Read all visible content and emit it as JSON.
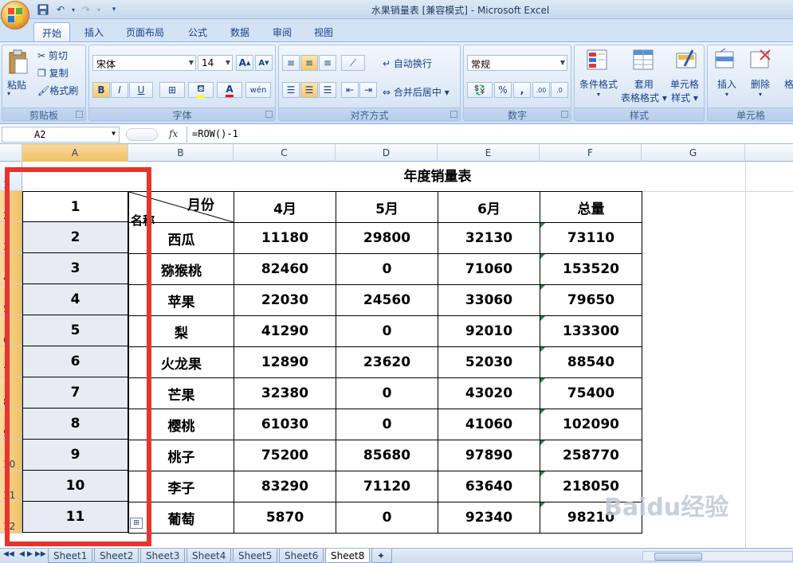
{
  "window": {
    "title": "水果销量表  [兼容模式] - Microsoft Excel"
  },
  "ribbon_tabs": [
    "开始",
    "插入",
    "页面布局",
    "公式",
    "数据",
    "审阅",
    "视图"
  ],
  "clipboard": {
    "paste": "粘贴",
    "cut": "剪切",
    "copy": "复制",
    "format_painter": "格式刷",
    "label": "剪贴板"
  },
  "font": {
    "name": "宋体",
    "size": "14",
    "bold": "B",
    "italic": "I",
    "underline": "U",
    "label": "字体",
    "phonetic": "wén"
  },
  "alignment": {
    "wrap": "自动换行",
    "merge": "合并后居中",
    "label": "对齐方式"
  },
  "number": {
    "format": "常规",
    "percent": "%",
    "comma": ",",
    "label": "数字"
  },
  "styles": {
    "conditional": "条件格式",
    "table_fmt_1": "套用",
    "table_fmt_2": "表格格式",
    "cell_styles_1": "单元格",
    "cell_styles_2": "样式",
    "label": "样式"
  },
  "cells": {
    "insert": "插入",
    "delete": "删除",
    "format": "格",
    "label": "单元格"
  },
  "formula_bar": {
    "name_box": "A2",
    "fx": "fx",
    "formula": "=ROW()-1"
  },
  "columns": [
    "A",
    "B",
    "C",
    "D",
    "E",
    "F",
    "G"
  ],
  "rows": [
    "1",
    "2",
    "3",
    "4",
    "5",
    "6",
    "7",
    "8",
    "9",
    "10",
    "11",
    "12"
  ],
  "sheet": {
    "title": "年度销量表",
    "header_diag_top": "月份",
    "header_diag_bottom": "名称",
    "headers": [
      "4月",
      "5月",
      "6月",
      "总量"
    ],
    "row_numbers": [
      "1",
      "2",
      "3",
      "4",
      "5",
      "6",
      "7",
      "8",
      "9",
      "10",
      "11"
    ],
    "fruits": [
      {
        "name": "西瓜",
        "m4": "11180",
        "m5": "29800",
        "m6": "32130",
        "total": "73110"
      },
      {
        "name": "猕猴桃",
        "m4": "82460",
        "m5": "0",
        "m6": "71060",
        "total": "153520"
      },
      {
        "name": "苹果",
        "m4": "22030",
        "m5": "24560",
        "m6": "33060",
        "total": "79650"
      },
      {
        "name": "梨",
        "m4": "41290",
        "m5": "0",
        "m6": "92010",
        "total": "133300"
      },
      {
        "name": "火龙果",
        "m4": "12890",
        "m5": "23620",
        "m6": "52030",
        "total": "88540"
      },
      {
        "name": "芒果",
        "m4": "32380",
        "m5": "0",
        "m6": "43020",
        "total": "75400"
      },
      {
        "name": "樱桃",
        "m4": "61030",
        "m5": "0",
        "m6": "41060",
        "total": "102090"
      },
      {
        "name": "桃子",
        "m4": "75200",
        "m5": "85680",
        "m6": "97890",
        "total": "258770"
      },
      {
        "name": "李子",
        "m4": "83290",
        "m5": "71120",
        "m6": "63640",
        "total": "218050"
      },
      {
        "name": "葡萄",
        "m4": "5870",
        "m5": "0",
        "m6": "92340",
        "total": "98210"
      }
    ]
  },
  "sheet_tabs": [
    "Sheet1",
    "Sheet2",
    "Sheet3",
    "Sheet4",
    "Sheet5",
    "Sheet6",
    "Sheet8"
  ],
  "active_sheet": "Sheet8",
  "watermark": "Baidu经验",
  "colors": {
    "highlight_box": "#e8332f",
    "selected_header": "#f1c15f",
    "ribbon_bg": "#d9e6f6"
  }
}
